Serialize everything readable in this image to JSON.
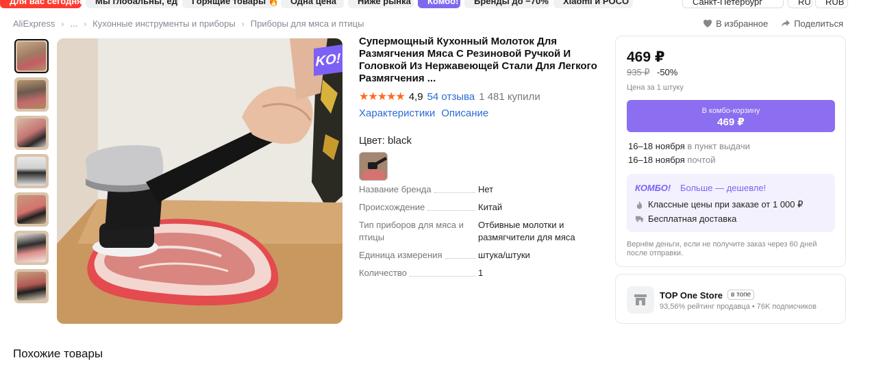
{
  "topbar": {
    "chips": [
      "Для вас сегодня",
      "Мы глобальны, едины",
      "Горящие товары 🔥",
      "Одна цена",
      "Ниже рынка",
      "Комбо!",
      "Бренды до −70%",
      "Xiaomi и POCO",
      "Санкт-Петербург",
      "RU",
      "RUB"
    ]
  },
  "breadcrumb": {
    "items": [
      "AliExpress",
      "...",
      "Кухонные инструменты и приборы",
      "Приборы для мяса и птицы"
    ]
  },
  "actions": {
    "favorite": "В избранное",
    "share": "Поделиться"
  },
  "gallery": {
    "badge": "KO!",
    "thumb_count": 7
  },
  "product": {
    "title": "Супермощный Кухонный Молоток Для Размягчения Мяса С Резиновой Ручкой И Головкой Из Нержавеющей Стали Для Легкого Размягчения ...",
    "rating": "4,9",
    "reviews": "54 отзыва",
    "bought": "1 481 купили",
    "link_specs": "Характеристики",
    "link_desc": "Описание",
    "color_label": "Цвет: black",
    "specs": [
      {
        "key": "Название бренда",
        "value": "Нет"
      },
      {
        "key": "Происхождение",
        "value": "Китай"
      },
      {
        "key": "Тип приборов для мяса и птицы",
        "value": "Отбивные молотки и размягчители для мяса"
      },
      {
        "key": "Единица измерения",
        "value": "штука/штуки"
      },
      {
        "key": "Количество",
        "value": "1"
      }
    ]
  },
  "price": {
    "current": "469 ₽",
    "old": "935 ₽",
    "discount": "-50%",
    "per_unit": "Цена за 1 штуку",
    "combo_btn_line1": "В комбо-корзину",
    "combo_btn_line2": "469 ₽",
    "delivery1_date": "16–18 ноября",
    "delivery1_method": "в пункт выдачи",
    "delivery2_date": "16–18 ноября",
    "delivery2_method": "почтой",
    "combo_logo": "КОМБО!",
    "combo_sub": "Больше — дешевле!",
    "combo_item1": "Классные цены при заказе от 1 000 ₽",
    "combo_item2": "Бесплатная доставка",
    "refund": "Вернём деньги, если не получите заказ через 60 дней после отправки."
  },
  "store": {
    "name": "TOP One Store",
    "badge": "в топе",
    "meta": "93,56% рейтинг продавца • 76K подписчиков"
  },
  "similar_title": "Похожие товары",
  "colors": {
    "accent": "#7d61f5",
    "link": "#2a6bd6",
    "star": "#ff6a1f",
    "sale_red": "#ff3b30"
  }
}
